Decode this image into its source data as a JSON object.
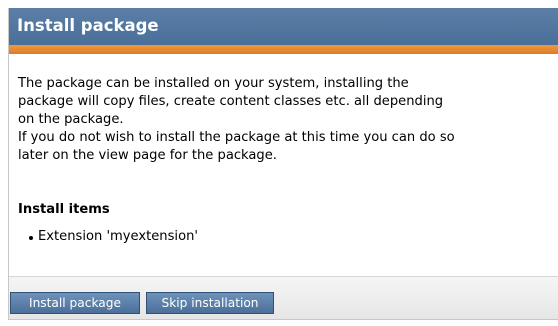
{
  "dialog": {
    "title": "Install package",
    "description_lines": [
      "The package can be installed on your system, installing the",
      "package will copy files, create content classes etc. all depending",
      "on the package.",
      "If you do not wish to install the package at this time you can do so",
      "later on the view page for the package."
    ],
    "install_items_heading": "Install items",
    "install_items": [
      "Extension 'myextension'"
    ],
    "buttons": {
      "install": "Install package",
      "skip": "Skip installation"
    }
  },
  "colors": {
    "header_bg": "#5b7fa7",
    "accent_orange": "#e0792a",
    "button_bg": "#5b7fa7",
    "footer_bg": "#eeeeee"
  }
}
